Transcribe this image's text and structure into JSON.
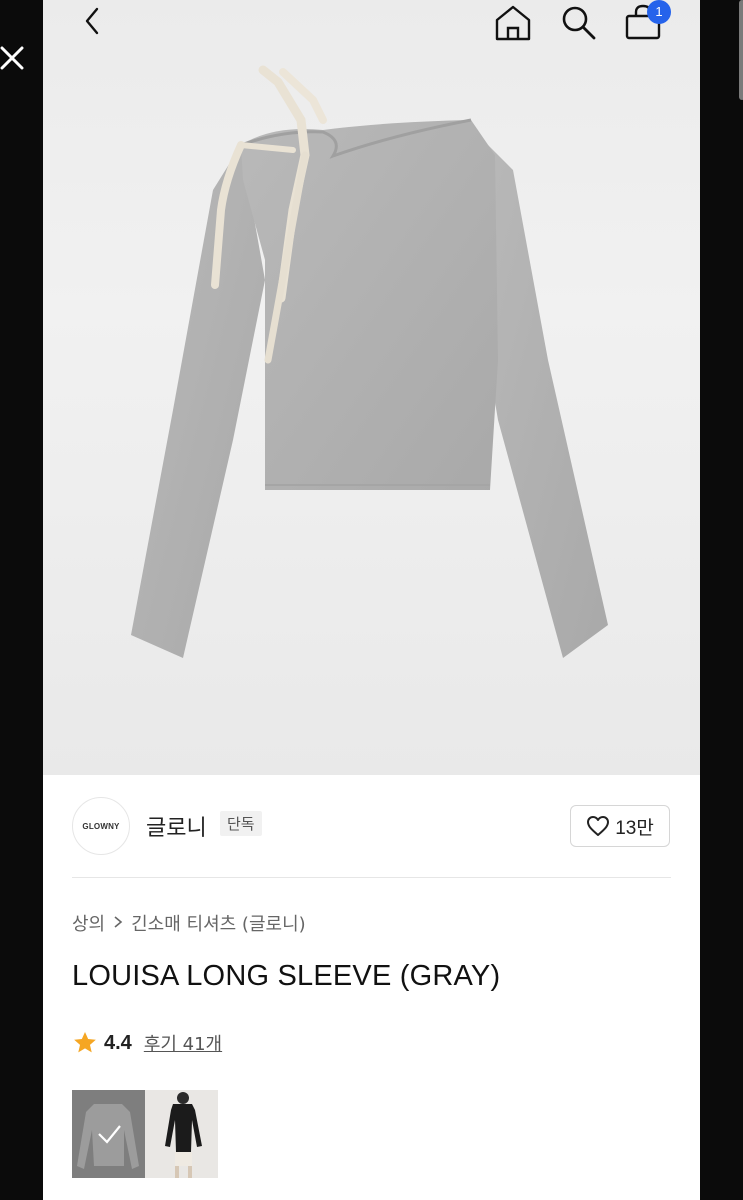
{
  "header": {
    "back_icon": "chevron-left-icon",
    "home_icon": "home-icon",
    "search_icon": "search-icon",
    "cart_icon": "shopping-bag-icon",
    "cart_count": "1",
    "close_icon": "close-icon"
  },
  "product": {
    "image_desc_icon": "product-image",
    "brand": {
      "logo_text": "GLOWNY",
      "name": "글로니",
      "tag": "단독"
    },
    "like": {
      "icon": "heart-icon",
      "count": "13만"
    },
    "breadcrumb": [
      "상의",
      "긴소매 티셔츠 (글로니)"
    ],
    "title": "LOUISA LONG SLEEVE (GRAY)",
    "rating": {
      "icon": "star-icon",
      "value": "4.4",
      "reviews_label": "후기 41개"
    },
    "thumbnails": [
      {
        "name": "gray-top-thumbnail",
        "selected": true
      },
      {
        "name": "black-top-thumbnail",
        "selected": false
      }
    ]
  },
  "colors": {
    "badge": "#2563eb",
    "star": "#f5a623"
  }
}
